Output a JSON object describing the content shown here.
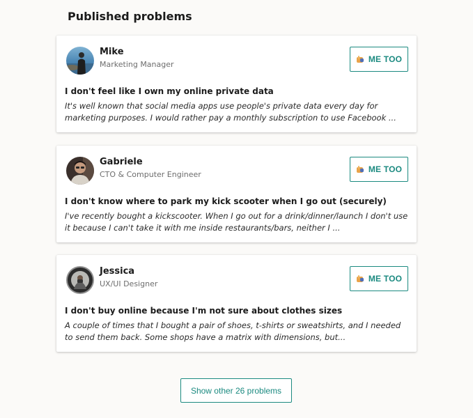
{
  "page": {
    "title": "Published problems",
    "accent_color": "#1b8a80"
  },
  "problems": [
    {
      "author": {
        "name": "Mike",
        "role": "Marketing Manager",
        "avatar": "person-at-sea-photo"
      },
      "me_too_label": "ME TOO",
      "title": "I don't feel like I own my online private data",
      "description": "It's well known that social media apps use people's private data every day for marketing purposes. I would rather pay a monthly subscription to use Facebook ..."
    },
    {
      "author": {
        "name": "Gabriele",
        "role": "CTO & Computer Engineer",
        "avatar": "person-portrait-photo"
      },
      "me_too_label": "ME TOO",
      "title": "I don't know where to park my kick scooter when I go out (securely)",
      "description": "I've recently bought a kickscooter. When I go out for a drink/dinner/launch I don't use it because I can't take it with me inside restaurants/bars, neither I ..."
    },
    {
      "author": {
        "name": "Jessica",
        "role": "UX/UI Designer",
        "avatar": "person-in-mirror-photo"
      },
      "me_too_label": "ME TOO",
      "title": "I don't buy online because I'm not sure about clothes sizes",
      "description": "A couple of times that I bought a pair of shoes, t-shirts or sweatshirts, and I needed to send them back. Some shops have a matrix with dimensions, but..."
    }
  ],
  "footer": {
    "show_more_label": "Show other 26 problems"
  }
}
